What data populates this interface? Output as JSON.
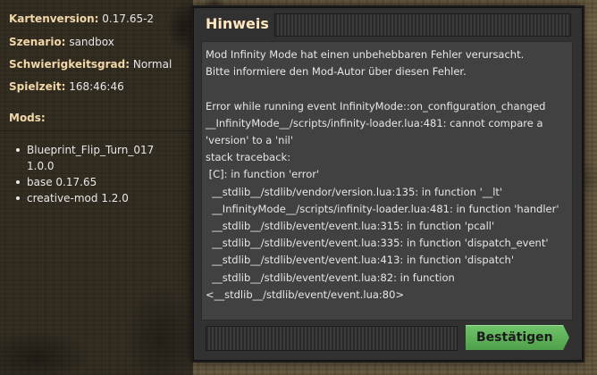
{
  "info_panel": {
    "map_version": {
      "key": "Kartenversion:",
      "value": "0.17.65-2"
    },
    "scenario": {
      "key": "Szenario:",
      "value": "sandbox"
    },
    "difficulty": {
      "key": "Schwierigkeitsgrad:",
      "value": "Normal"
    },
    "playtime": {
      "key": "Spielzeit:",
      "value": "168:46:46"
    },
    "mods_label": "Mods:",
    "mods": [
      {
        "line1": "Blueprint_Flip_Turn_017",
        "line2": "1.0.0"
      },
      {
        "line1": "base 0.17.65"
      },
      {
        "line1": "creative-mod 1.2.0"
      }
    ]
  },
  "dialog": {
    "title": "Hinweis",
    "message": "Mod Infinity Mode hat einen unbehebbaren Fehler verursacht.\nBitte informiere den Mod-Autor über diesen Fehler.\n\nError while running event InfinityMode::on_configuration_changed\n__InfinityMode__/scripts/infinity-loader.lua:481: cannot compare a\n'version' to a 'nil'\nstack traceback:\n [C]: in function 'error'\n  __stdlib__/stdlib/vendor/version.lua:135: in function '__lt'\n  __InfinityMode__/scripts/infinity-loader.lua:481: in function 'handler'\n  __stdlib__/stdlib/event/event.lua:315: in function 'pcall'\n  __stdlib__/stdlib/event/event.lua:335: in function 'dispatch_event'\n  __stdlib__/stdlib/event/event.lua:413: in function 'dispatch'\n  __stdlib__/stdlib/event/event.lua:82: in function\n<__stdlib__/stdlib/event/event.lua:80>",
    "confirm_label": "Bestätigen"
  }
}
